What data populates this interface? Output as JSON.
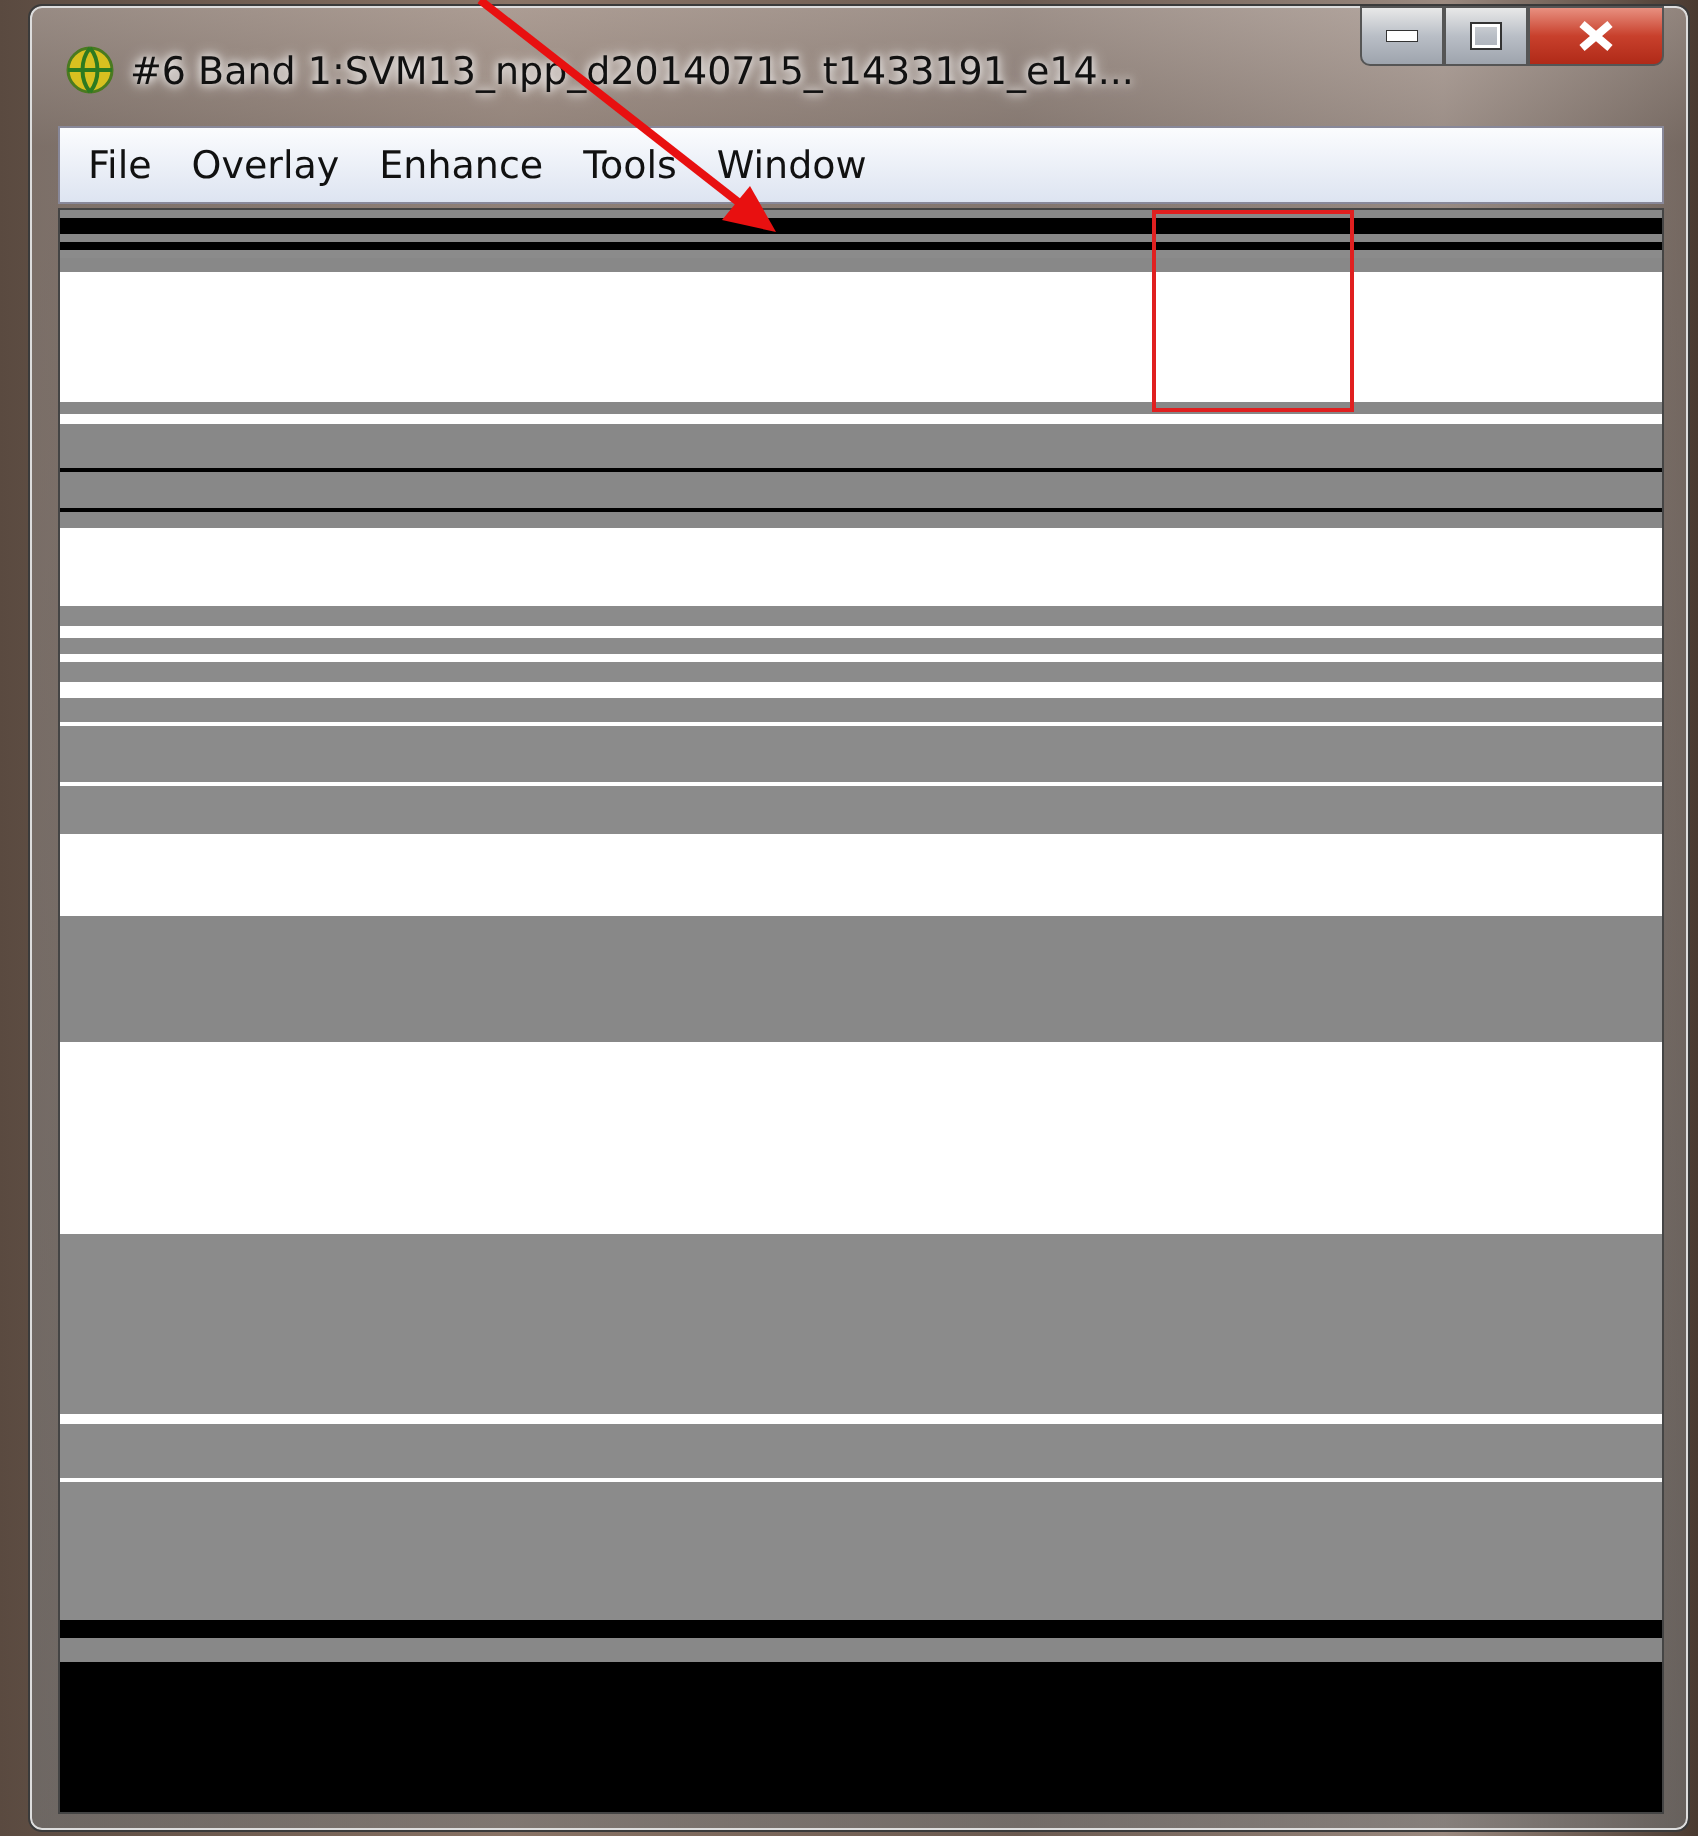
{
  "window": {
    "title": "#6 Band 1:SVM13_npp_d20140715_t1433191_e14..."
  },
  "menu": [
    "File",
    "Overlay",
    "Enhance",
    "Tools",
    "Window"
  ]
}
